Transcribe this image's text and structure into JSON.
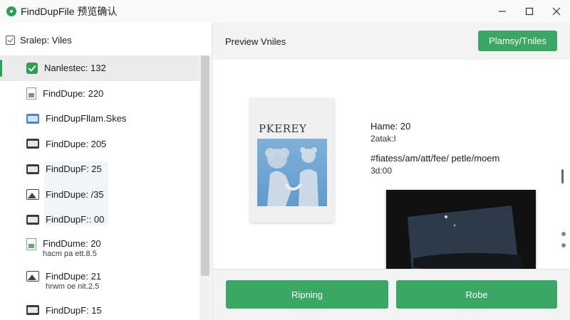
{
  "window": {
    "title": "FindDupFile 预览确认",
    "controls": [
      "minimize",
      "maximize",
      "close"
    ]
  },
  "sidebar": {
    "header_label": "Sralep: Viles",
    "items": [
      {
        "icon": "checkbox-checked-icon",
        "label": "Nanlestec: 132",
        "sub": "",
        "selected": true
      },
      {
        "icon": "image-file-icon",
        "label": "FindDupe: 220",
        "sub": ""
      },
      {
        "icon": "folder-icon",
        "label": "FindDupFllam.Skes",
        "sub": ""
      },
      {
        "icon": "dark-file-icon",
        "label": "FindDupe: 205",
        "sub": ""
      },
      {
        "icon": "folder-dark-icon",
        "label": "FindDupF: 25",
        "sub": ""
      },
      {
        "icon": "landscape-image-icon",
        "label": "FindDupe: /35",
        "sub": ""
      },
      {
        "icon": "dark-file-icon",
        "label": "FindDupF:: 00",
        "sub": ""
      },
      {
        "icon": "image-file-icon",
        "label": "FindDume: 20",
        "sub": "hacm pa ett.8.5"
      },
      {
        "icon": "landscape-image-icon",
        "label": "FindDupe: 21",
        "sub": "hrwm oe nit.2.5"
      },
      {
        "icon": "folder-dark-icon",
        "label": "FindDupF: 15",
        "sub": ""
      }
    ]
  },
  "main": {
    "header_title": "Preview Vniles",
    "primary_button": "Plamsy/Tniles",
    "preview": {
      "photo_caption": "PKEREY",
      "name": "Hame: 20",
      "name_sub": "2atak:l",
      "path": "#fiatess/am/att/fee/ petle/moem",
      "size": "3d:00"
    },
    "actions": {
      "left_button": "Ripning",
      "right_button": "Robe"
    }
  },
  "colors": {
    "accent": "#3aa864",
    "selected_row": "#ebebeb"
  }
}
